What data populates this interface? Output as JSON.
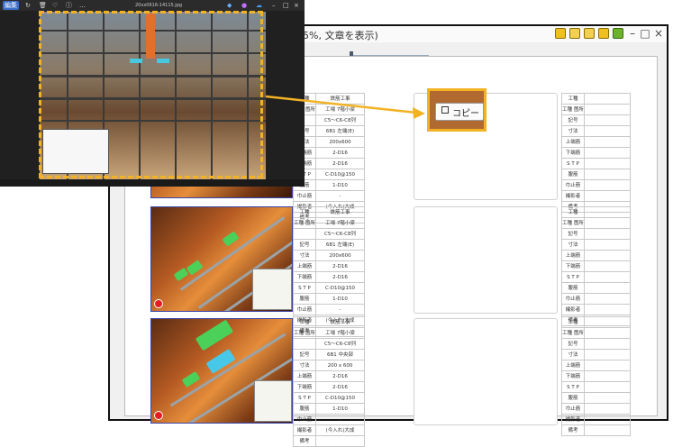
{
  "viewer": {
    "menu_label": "編集",
    "file_name": "20xx0616-14115.jpg"
  },
  "document": {
    "title": "5%, 文章を表示)"
  },
  "popup": {
    "copy_label": "コピー"
  },
  "records": [
    {
      "rows": [
        [
          "工種",
          "鉄筋工事"
        ],
        [
          "工種\n箇所",
          "工場 7階小梁"
        ],
        [
          "",
          "C5〜C6-C8列"
        ],
        [
          "記号",
          "6B1 左端(E)"
        ],
        [
          "寸法",
          "200x600"
        ],
        [
          "上端筋",
          "2-D16"
        ],
        [
          "下端筋",
          "2-D16"
        ],
        [
          "S T P",
          "C-D10@150"
        ],
        [
          "腹筋",
          "1-D10"
        ],
        [
          "巾止筋",
          "-"
        ],
        [
          "撮影者",
          "(今入れ)大成"
        ],
        [
          "備考",
          ""
        ]
      ]
    },
    {
      "rows": [
        [
          "工種",
          "鉄筋工事"
        ],
        [
          "工種\n箇所",
          "工場 7階小梁"
        ],
        [
          "",
          "C5〜C6-C8列"
        ],
        [
          "記号",
          "6B1 左端(E)"
        ],
        [
          "寸法",
          "200x600"
        ],
        [
          "上端筋",
          "2-D16"
        ],
        [
          "下端筋",
          "2-D16"
        ],
        [
          "S T P",
          "C-D10@150"
        ],
        [
          "腹筋",
          "1-D10"
        ],
        [
          "巾止筋",
          "-"
        ],
        [
          "撮影者",
          "(今入れ)大成"
        ],
        [
          "備考",
          ""
        ]
      ]
    },
    {
      "rows": [
        [
          "工種",
          "鉄筋工事"
        ],
        [
          "工種\n箇所",
          "工場 7階小梁"
        ],
        [
          "",
          "C5〜C6-C8列"
        ],
        [
          "記号",
          "6B1 中央部"
        ],
        [
          "寸法",
          "200 x 600"
        ],
        [
          "上端筋",
          "2-D16"
        ],
        [
          "下端筋",
          "2-D16"
        ],
        [
          "S T P",
          "C-D10@150"
        ],
        [
          "腹筋",
          "1-D10"
        ],
        [
          "巾止筋",
          "-"
        ],
        [
          "撮影者",
          "(今入れ)大成"
        ],
        [
          "備考",
          ""
        ]
      ]
    }
  ],
  "blank_rows": [
    "工種",
    "工種\n箇所",
    "記号",
    "寸法",
    "上端筋",
    "下端筋",
    "S T P",
    "腹筋",
    "巾止筋",
    "撮影者",
    "備考"
  ],
  "colors": {
    "accent": "#f2b224",
    "frame": "#3b45a8"
  }
}
